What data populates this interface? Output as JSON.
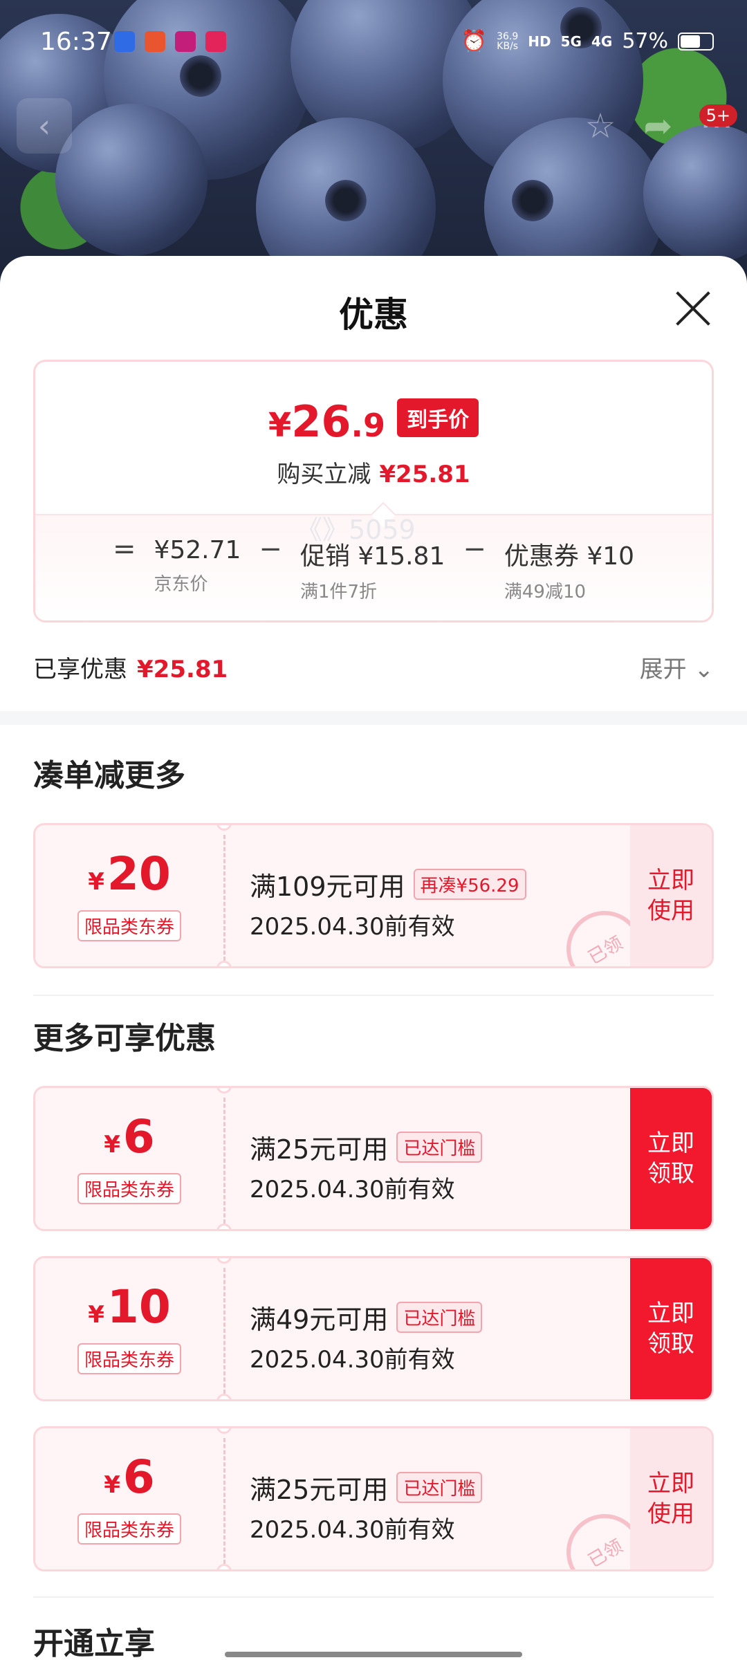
{
  "status_bar": {
    "time": "16:37",
    "net_speed": "36.9",
    "net_unit": "KB/s",
    "hd": "HD",
    "sig5g": "5G",
    "sig4g": "4G",
    "battery": "57%"
  },
  "nav": {
    "badge": "5+"
  },
  "sheet": {
    "title": "优惠",
    "price": {
      "yen": "¥",
      "int": "26",
      "dec": ".9",
      "tag": "到手价"
    },
    "instant_off_label": "购买立减",
    "instant_off_value": "¥25.81",
    "calc": {
      "eq": "=",
      "jd_price": "¥52.71",
      "jd_price_label": "京东价",
      "minus1": "−",
      "promo": "促销 ¥15.81",
      "promo_label": "满1件7折",
      "minus2": "−",
      "coupon": "优惠券 ¥10",
      "coupon_label": "满49减10"
    },
    "enjoyed_label": "已享优惠",
    "enjoyed_value": "¥25.81",
    "expand_label": "展开"
  },
  "section1": {
    "title": "凑单减更多",
    "watermark": "《》5059"
  },
  "section2": {
    "title": "更多可享优惠"
  },
  "section3": {
    "title": "开通立享"
  },
  "coupons": [
    {
      "yen": "¥",
      "amount": "20",
      "tag": "限品类东券",
      "cond": "满109元可用",
      "cond_tag": "再凑¥56.29",
      "date": "2025.04.30前有效",
      "action": "立即\n使用",
      "stamp": "已领"
    },
    {
      "yen": "¥",
      "amount": "6",
      "tag": "限品类东券",
      "cond": "满25元可用",
      "cond_tag": "已达门槛",
      "date": "2025.04.30前有效",
      "action": "立即\n领取"
    },
    {
      "yen": "¥",
      "amount": "10",
      "tag": "限品类东券",
      "cond": "满49元可用",
      "cond_tag": "已达门槛",
      "date": "2025.04.30前有效",
      "action": "立即\n领取"
    },
    {
      "yen": "¥",
      "amount": "6",
      "tag": "限品类东券",
      "cond": "满25元可用",
      "cond_tag": "已达门槛",
      "date": "2025.04.30前有效",
      "action": "立即\n使用",
      "stamp": "已领"
    }
  ]
}
